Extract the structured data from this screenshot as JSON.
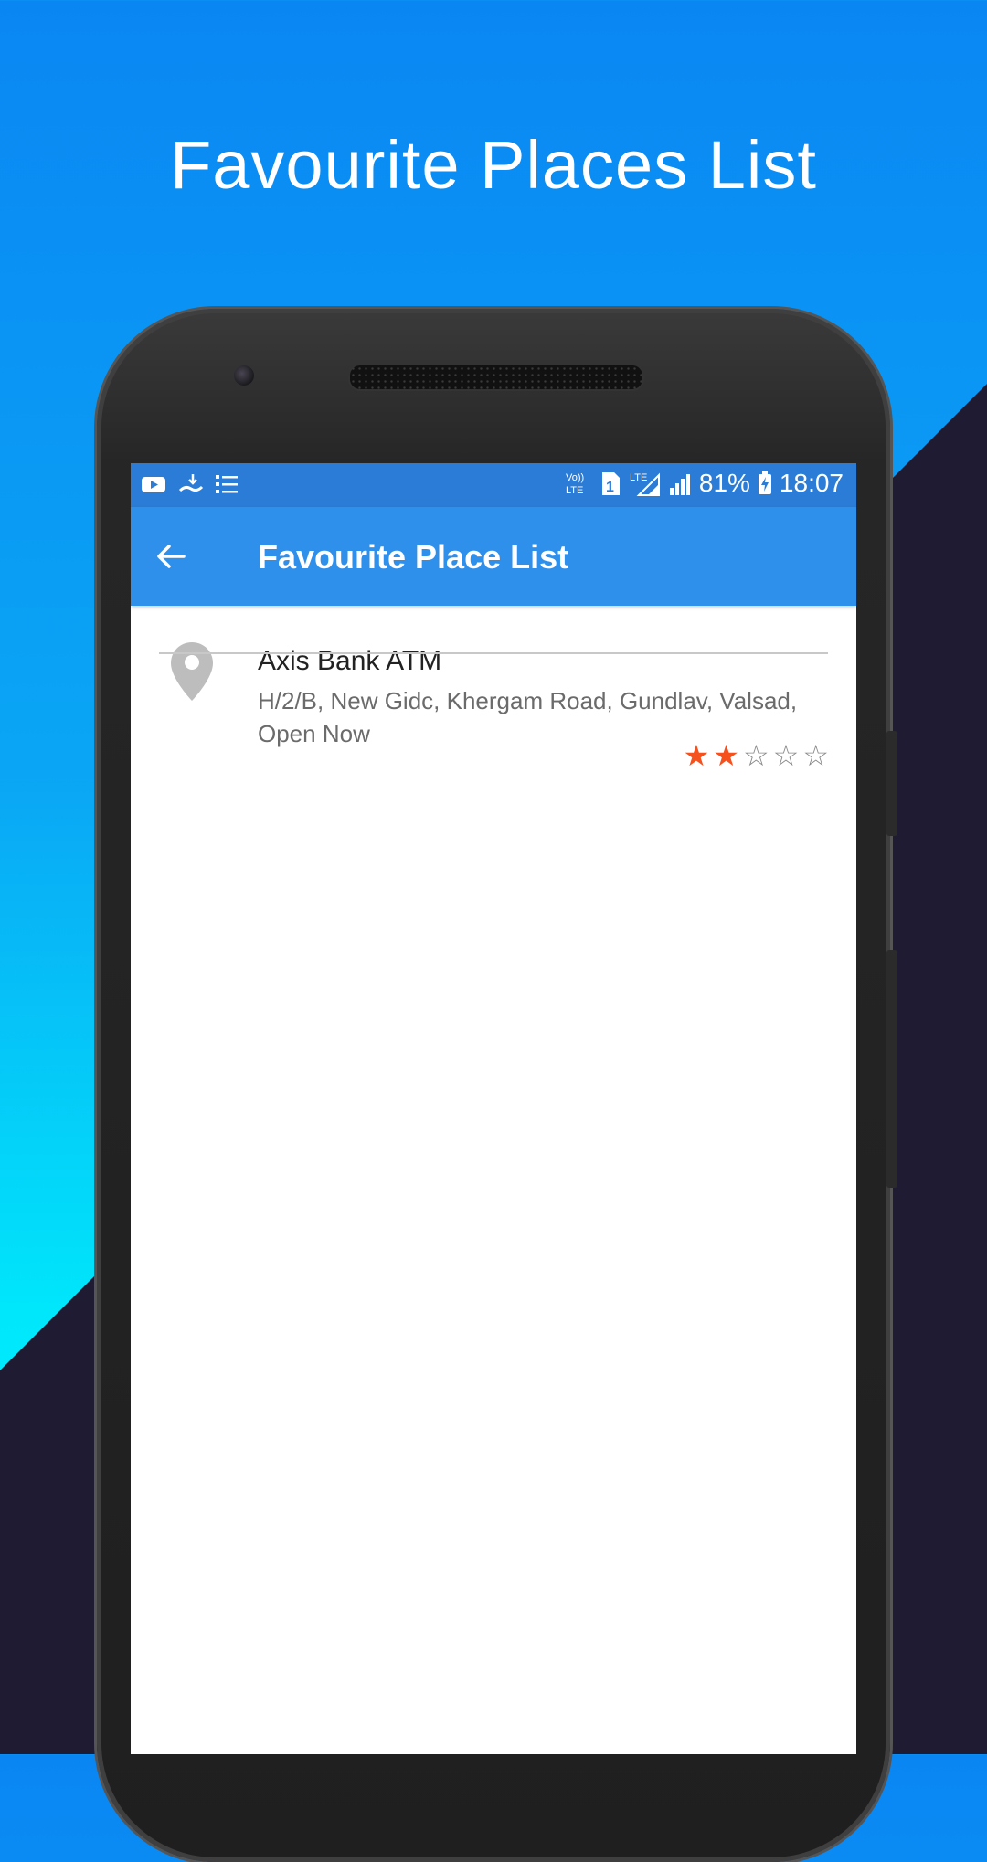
{
  "promo": {
    "title": "Favourite Places List"
  },
  "status_bar": {
    "volte": "Vo)) LTE",
    "sim": "1",
    "network": "LTE",
    "battery": "81%",
    "time": "18:07"
  },
  "app_bar": {
    "title": "Favourite Place List"
  },
  "places": [
    {
      "name": "Axis Bank ATM",
      "address": "H/2/B, New Gidc, Khergam Road, Gundlav, Valsad, Open Now",
      "rating": 2,
      "rating_max": 5
    }
  ],
  "colors": {
    "accent": "#2f90ec",
    "status_bar": "#2a7cd6",
    "star_on": "#f4511e"
  }
}
